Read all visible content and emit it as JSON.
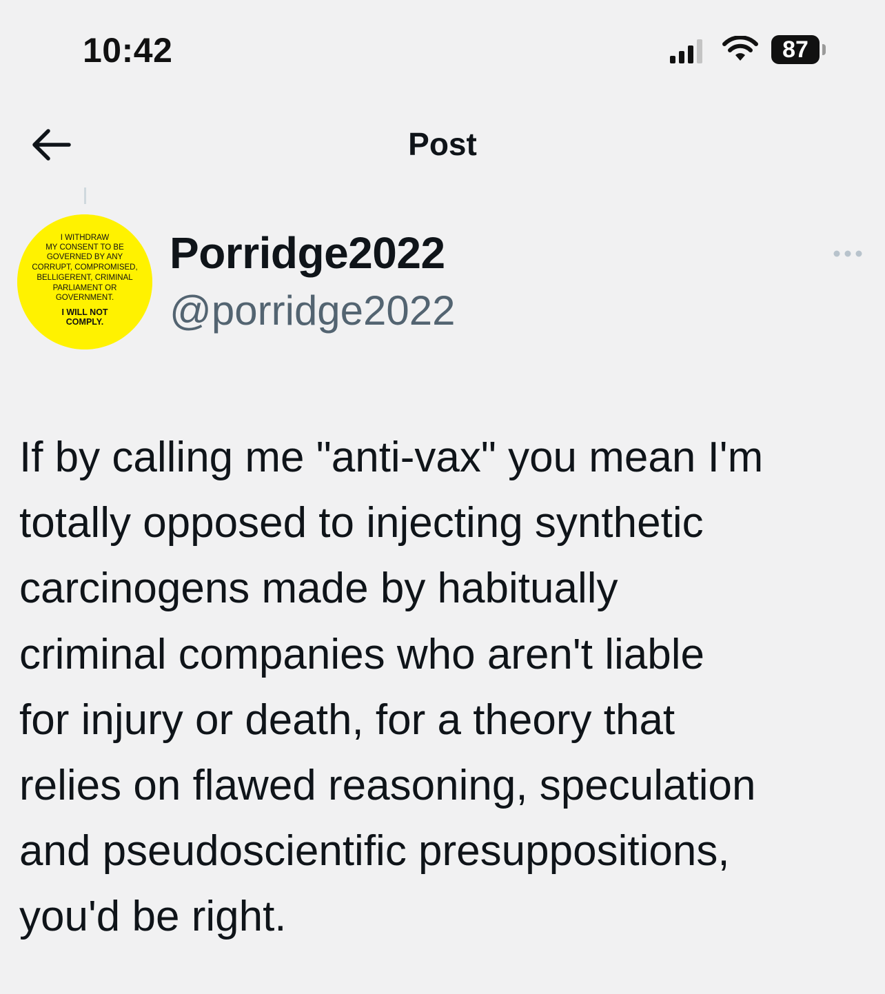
{
  "status_bar": {
    "time": "10:42",
    "battery_level": "87",
    "signal_icon": "cellular-signal-icon",
    "wifi_icon": "wifi-icon"
  },
  "header": {
    "title": "Post",
    "back_icon": "arrow-left-icon"
  },
  "author": {
    "display_name": "Porridge2022",
    "handle": "@porridge2022",
    "avatar_text": [
      "I WITHDRAW",
      "MY CONSENT TO BE",
      "GOVERNED BY ANY",
      "CORRUPT, COMPROMISED,",
      "BELLIGERENT, CRIMINAL",
      "PARLIAMENT OR",
      "GOVERNMENT.",
      "I WILL NOT",
      "COMPLY."
    ],
    "avatar_color": "#fff200",
    "more_icon": "more-dots-icon"
  },
  "post": {
    "text": "If by calling me \"anti-vax\" you mean I'm\ntotally opposed to injecting synthetic\ncarcinogens made by habitually\ncriminal companies who aren't liable\nfor injury or death, for a theory that\nrelies on flawed reasoning, speculation\nand pseudoscientific presuppositions,\nyou'd be right."
  },
  "colors": {
    "background": "#f1f1f2",
    "text_primary": "#0f1419",
    "text_secondary": "#536471"
  }
}
